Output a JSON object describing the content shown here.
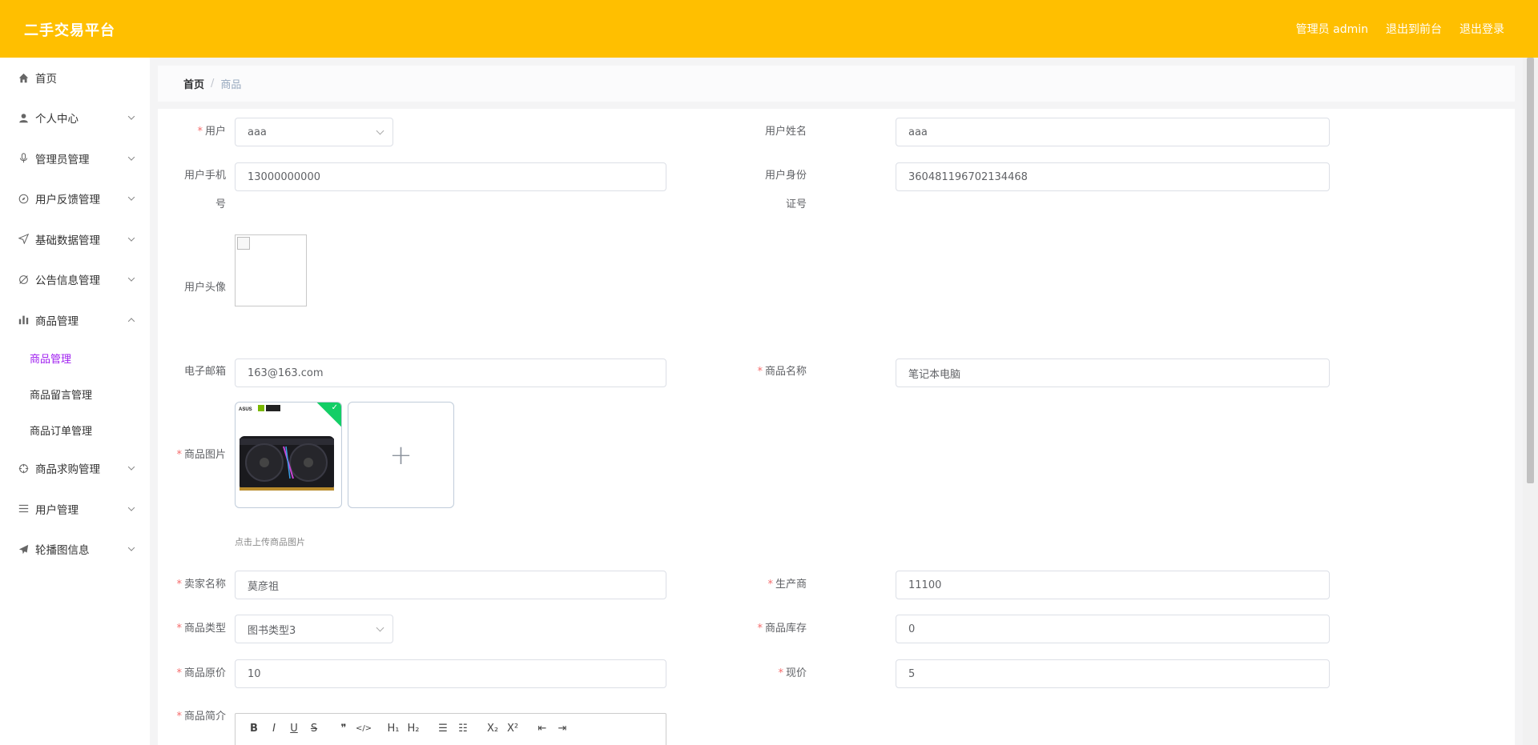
{
  "header": {
    "brand": "二手交易平台",
    "admin_label": "管理员 admin",
    "to_front": "退出到前台",
    "logout": "退出登录"
  },
  "sidebar": {
    "items": [
      {
        "label": "首页",
        "icon": "home-icon"
      },
      {
        "label": "个人中心",
        "icon": "user-icon"
      },
      {
        "label": "管理员管理",
        "icon": "microphone-icon"
      },
      {
        "label": "用户反馈管理",
        "icon": "compass-icon"
      },
      {
        "label": "基础数据管理",
        "icon": "send-icon"
      },
      {
        "label": "公告信息管理",
        "icon": "bell-off-icon"
      },
      {
        "label": "商品管理",
        "icon": "bar-chart-icon",
        "expanded": true
      },
      {
        "label": "商品求购管理",
        "icon": "crosshair-icon"
      },
      {
        "label": "用户管理",
        "icon": "list-icon"
      },
      {
        "label": "轮播图信息",
        "icon": "paper-plane-icon"
      }
    ],
    "submenu": [
      "商品管理",
      "商品留言管理",
      "商品订单管理"
    ],
    "active_sub": "商品管理",
    "active_color": "#a020f0"
  },
  "breadcrumb": {
    "home": "首页",
    "separator": "/",
    "current": "商品"
  },
  "form": {
    "user": {
      "label": "用户",
      "value": "aaa"
    },
    "user_name": {
      "label": "用户姓名",
      "value": "aaa"
    },
    "phone": {
      "label_line1": "用户手机",
      "label_line2": "号",
      "value": "13000000000"
    },
    "id_card": {
      "label_line1": "用户身份",
      "label_line2": "证号",
      "value": "360481196702134468"
    },
    "avatar": {
      "label": "用户头像"
    },
    "email": {
      "label": "电子邮箱",
      "value": "163@163.com"
    },
    "goods_name": {
      "label": "商品名称",
      "value": "笔记本电脑"
    },
    "goods_image": {
      "label": "商品图片",
      "tip": "点击上传商品图片",
      "thumb_brand": "ASUS"
    },
    "seller": {
      "label": "卖家名称",
      "value": "莫彦祖"
    },
    "manufacturer": {
      "label": "生产商",
      "value": "11100"
    },
    "goods_type": {
      "label": "商品类型",
      "value": "图书类型3"
    },
    "stock": {
      "label": "商品库存",
      "value": "0"
    },
    "original_price": {
      "label": "商品原价",
      "value": "10"
    },
    "current_price": {
      "label": "现价",
      "value": "5"
    },
    "intro": {
      "label": "商品简介"
    }
  },
  "editor_toolbar": {
    "bold": "B",
    "italic": "I",
    "underline": "U",
    "strike": "S",
    "quote": "❞",
    "code": "</>",
    "h1": "H₁",
    "h2": "H₂",
    "ordered_list": "☰",
    "bullet_list": "☷",
    "sub": "X₂",
    "sup": "X²",
    "outdent": "⇤",
    "indent": "⇥"
  },
  "colors": {
    "header": "#ffbf00",
    "required": "#f56c6c",
    "success": "#13ce66"
  }
}
